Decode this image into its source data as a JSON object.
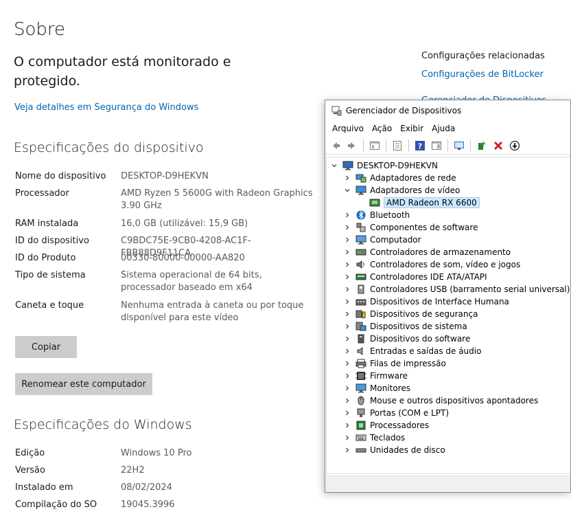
{
  "settings": {
    "page_title": "Sobre",
    "status_text": "O computador está monitorado e protegido.",
    "security_link": "Veja detalhes em Segurança do Windows",
    "device_specs": {
      "title": "Especificações do dispositivo",
      "rows": [
        {
          "label": "Nome do dispositivo",
          "value": "DESKTOP-D9HEKVN"
        },
        {
          "label": "Processador",
          "value": "AMD Ryzen 5 5600G with Radeon Graphics 3.90 GHz"
        },
        {
          "label": "RAM instalada",
          "value": "16,0 GB (utilizável: 15,9 GB)"
        },
        {
          "label": "ID do dispositivo",
          "value": "C9BDC75E-9CB0-4208-AC1F-FBB88D9F11CA"
        },
        {
          "label": "ID do Produto",
          "value": "00330-80000-00000-AA820"
        },
        {
          "label": "Tipo de sistema",
          "value": "Sistema operacional de 64 bits, processador baseado em x64"
        },
        {
          "label": "Caneta e toque",
          "value": "Nenhuma entrada à caneta ou por toque disponível para este vídeo"
        }
      ],
      "copy_button": "Copiar",
      "rename_button": "Renomear este computador"
    },
    "windows_specs": {
      "title": "Especificações do Windows",
      "rows": [
        {
          "label": "Edição",
          "value": "Windows 10 Pro"
        },
        {
          "label": "Versão",
          "value": "22H2"
        },
        {
          "label": "Instalado em",
          "value": "08/02/2024"
        },
        {
          "label": "Compilação do SO",
          "value": "19045.3996"
        }
      ]
    },
    "related": {
      "title": "Configurações relacionadas",
      "links": [
        "Configurações de BitLocker",
        "Gerenciador de Dispositivos"
      ]
    }
  },
  "device_manager": {
    "title": "Gerenciador de Dispositivos",
    "menu": [
      "Arquivo",
      "Ação",
      "Exibir",
      "Ajuda"
    ],
    "toolbar_icons": [
      "back-arrow-icon",
      "forward-arrow-icon",
      "show-hide-tree-icon",
      "properties-icon",
      "help-icon",
      "action-pane-icon",
      "monitor-scan-icon",
      "update-driver-icon",
      "uninstall-x-icon",
      "disable-device-icon"
    ],
    "root": "DESKTOP-D9HEKVN",
    "categories": [
      {
        "label": "Adaptadores de rede",
        "icon": "network-adapter-icon",
        "expanded": false
      },
      {
        "label": "Adaptadores de vídeo",
        "icon": "display-adapter-icon",
        "expanded": true,
        "children": [
          {
            "label": "AMD Radeon RX 6600",
            "icon": "gpu-icon",
            "selected": true
          }
        ]
      },
      {
        "label": "Bluetooth",
        "icon": "bluetooth-icon",
        "expanded": false
      },
      {
        "label": "Componentes de software",
        "icon": "software-component-icon",
        "expanded": false
      },
      {
        "label": "Computador",
        "icon": "computer-icon",
        "expanded": false
      },
      {
        "label": "Controladores de armazenamento",
        "icon": "storage-controller-icon",
        "expanded": false
      },
      {
        "label": "Controladores de som, vídeo e jogos",
        "icon": "sound-icon",
        "expanded": false
      },
      {
        "label": "Controladores IDE ATA/ATAPI",
        "icon": "ide-controller-icon",
        "expanded": false
      },
      {
        "label": "Controladores USB (barramento serial universal)",
        "icon": "usb-icon",
        "expanded": false
      },
      {
        "label": "Dispositivos de Interface Humana",
        "icon": "hid-icon",
        "expanded": false
      },
      {
        "label": "Dispositivos de segurança",
        "icon": "security-device-icon",
        "expanded": false
      },
      {
        "label": "Dispositivos de sistema",
        "icon": "system-device-icon",
        "expanded": false
      },
      {
        "label": "Dispositivos do software",
        "icon": "software-device-icon",
        "expanded": false
      },
      {
        "label": "Entradas e saídas de áudio",
        "icon": "audio-io-icon",
        "expanded": false
      },
      {
        "label": "Filas de impressão",
        "icon": "print-queue-icon",
        "expanded": false
      },
      {
        "label": "Firmware",
        "icon": "firmware-icon",
        "expanded": false
      },
      {
        "label": "Monitores",
        "icon": "monitor-icon",
        "expanded": false
      },
      {
        "label": "Mouse e outros dispositivos apontadores",
        "icon": "mouse-icon",
        "expanded": false
      },
      {
        "label": "Portas (COM e LPT)",
        "icon": "port-icon",
        "expanded": false
      },
      {
        "label": "Processadores",
        "icon": "processor-icon",
        "expanded": false
      },
      {
        "label": "Teclados",
        "icon": "keyboard-icon",
        "expanded": false
      },
      {
        "label": "Unidades de disco",
        "icon": "disk-drive-icon",
        "expanded": false
      }
    ]
  },
  "colors": {
    "link": "#0063b1",
    "button": "#cccccc",
    "selection": "#cce8ff"
  }
}
